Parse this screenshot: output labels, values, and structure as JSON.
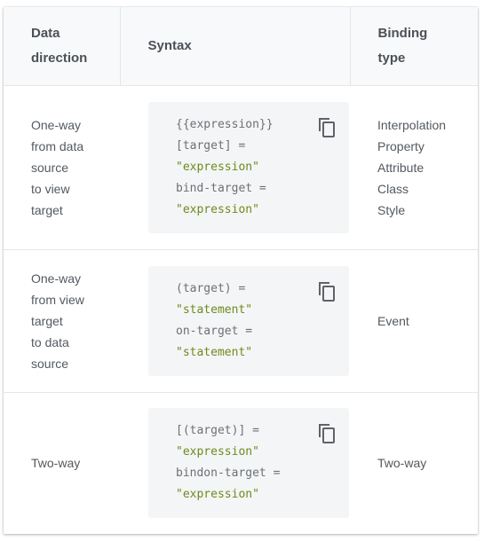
{
  "table": {
    "headers": {
      "data_direction": [
        "Data",
        "direction"
      ],
      "syntax": "Syntax",
      "binding_type": [
        "Binding",
        "type"
      ]
    },
    "rows": [
      {
        "direction": [
          "One-way",
          "from data",
          "source",
          "to view",
          "target"
        ],
        "code": [
          {
            "text": "{{expression}}",
            "kind": "plain"
          },
          {
            "text": "[target] =",
            "kind": "plain"
          },
          {
            "text": "\"expression\"",
            "kind": "str"
          },
          {
            "text": "bind-target =",
            "kind": "plain"
          },
          {
            "text": "\"expression\"",
            "kind": "str"
          }
        ],
        "binding_type": [
          "Interpolation",
          "Property",
          "Attribute",
          "Class",
          "Style"
        ]
      },
      {
        "direction": [
          "One-way",
          "from view",
          "target",
          "to data",
          "source"
        ],
        "code": [
          {
            "text": "(target) =",
            "kind": "plain"
          },
          {
            "text": "\"statement\"",
            "kind": "str"
          },
          {
            "text": "on-target =",
            "kind": "plain"
          },
          {
            "text": "\"statement\"",
            "kind": "str"
          }
        ],
        "binding_type": [
          "Event"
        ]
      },
      {
        "direction": [
          "Two-way"
        ],
        "code": [
          {
            "text": "[(target)] =",
            "kind": "plain"
          },
          {
            "text": "\"expression\"",
            "kind": "str"
          },
          {
            "text": "bindon-target =",
            "kind": "plain"
          },
          {
            "text": "\"expression\"",
            "kind": "str"
          }
        ],
        "binding_type": [
          "Two-way"
        ]
      }
    ]
  },
  "icons": {
    "copy": "copy-icon"
  },
  "colors": {
    "header_bg": "#f8f9fa",
    "code_bg": "#f4f5f6",
    "string": "#6e8a1e",
    "text": "#53595f",
    "border": "#e4e7ea"
  }
}
